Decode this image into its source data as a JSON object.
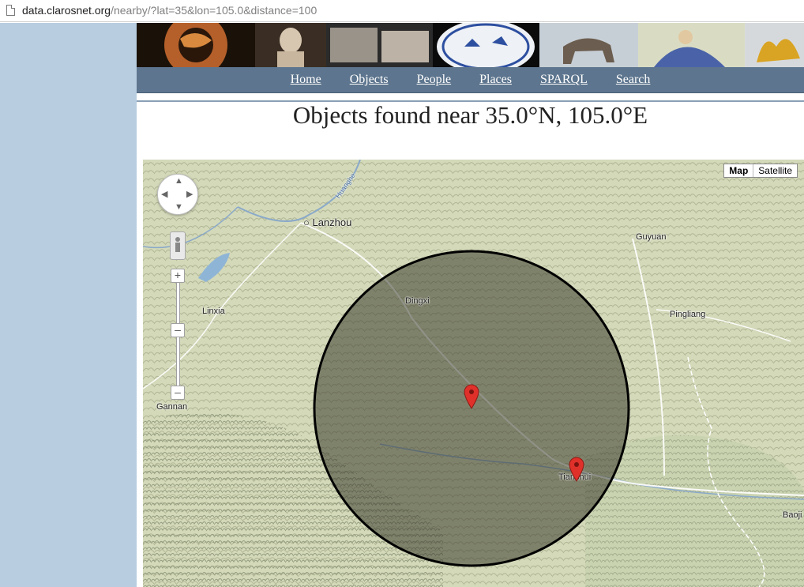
{
  "browser": {
    "url_host": "data.clarosnet.org",
    "url_path": "/nearby/?lat=35&lon=105.0&distance=100"
  },
  "nav": {
    "items": [
      "Home",
      "Objects",
      "People",
      "Places",
      "SPARQL",
      "Search"
    ]
  },
  "page": {
    "title": "Objects found near 35.0°N, 105.0°E"
  },
  "map": {
    "type_controls": [
      "Map",
      "Satellite"
    ],
    "places": [
      "Lanzhou",
      "Guyuan",
      "Dingxi",
      "Linxia",
      "Pingliang",
      "Gannan",
      "Tianshui",
      "Baoji",
      "Huanghe"
    ],
    "markers": [
      "marker-center",
      "marker-tianshui"
    ],
    "colors": {
      "circle_fill": "#3b3a2c",
      "circle_stroke": "#000000",
      "marker": "#e0302a",
      "land": "#cfd6b4"
    }
  }
}
